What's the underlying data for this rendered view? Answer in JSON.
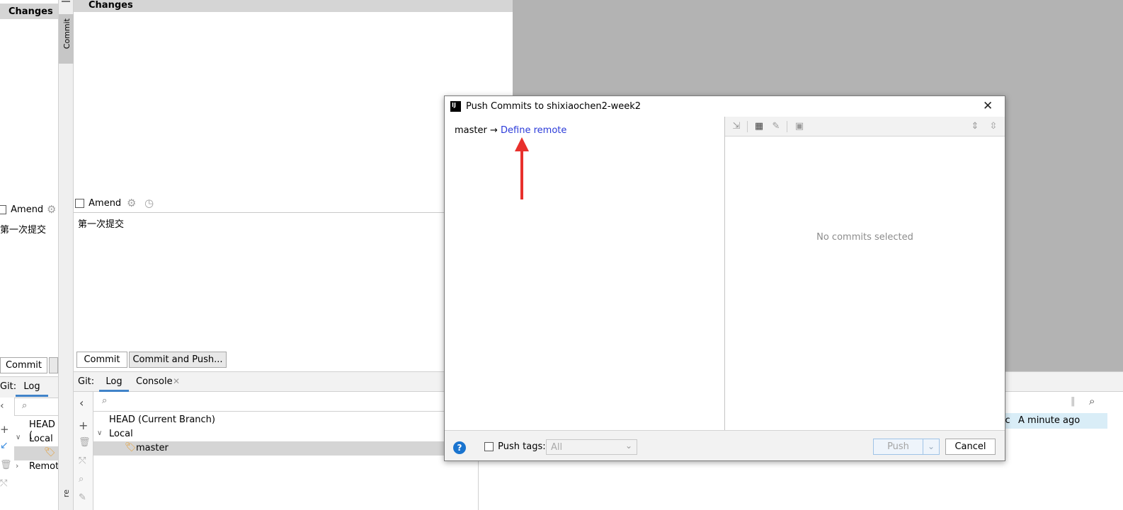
{
  "left_panel": {
    "header": "Changes",
    "amend_label": "Amend",
    "commit_message": "第一次提交",
    "commit_button": "Commit",
    "git_label": "Git:",
    "log_tab": "Log",
    "tree": {
      "head": "HEAD (",
      "local": "Local",
      "remote": "Remote"
    }
  },
  "tool_strip": {
    "commit_tab": "Commit"
  },
  "main_panel": {
    "header": "Changes",
    "amend_label": "Amend",
    "commit_message": "第一次提交",
    "commit_button": "Commit",
    "commit_push_button": "Commit and Push..."
  },
  "bottom_panel": {
    "git_label": "Git:",
    "tabs": [
      "Log",
      "Console"
    ],
    "tree": {
      "head": "HEAD (Current Branch)",
      "local": "Local",
      "branch": "master"
    },
    "log_row": {
      "author_fragment": "xc",
      "time": "A minute ago"
    }
  },
  "dialog": {
    "title": "Push Commits to shixiaochen2-week2",
    "branch": "master",
    "arrow": "→",
    "define_remote": "Define remote",
    "empty_state": "No commits selected",
    "push_tags_label": "Push tags:",
    "tags_select_value": "All",
    "push_button": "Push",
    "cancel_button": "Cancel",
    "help_glyph": "?"
  },
  "annotation": {
    "color": "#e8302c"
  }
}
